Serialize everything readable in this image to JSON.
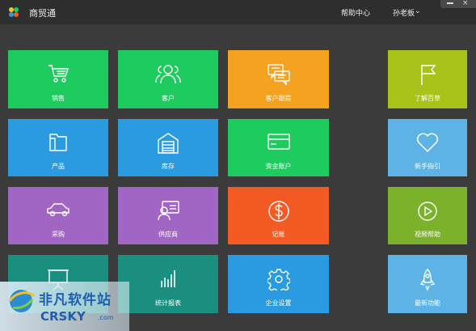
{
  "header": {
    "app_title": "商贸通",
    "help_label": "帮助中心",
    "user_label": "孙老板",
    "user_caret": "⌄",
    "close_glyph": "×"
  },
  "tiles": [
    {
      "label": "销售",
      "icon": "cart-icon",
      "color": "#1ecb5f"
    },
    {
      "label": "客户",
      "icon": "people-icon",
      "color": "#1ecb5f"
    },
    {
      "label": "客户跟踪",
      "icon": "chat-icon",
      "color": "#f4a21f"
    },
    {
      "label": "了解百草",
      "icon": "flag-icon",
      "color": "#a9c31a"
    },
    {
      "label": "产品",
      "icon": "folder-icon",
      "color": "#2a9be0"
    },
    {
      "label": "库存",
      "icon": "warehouse-icon",
      "color": "#2a9be0"
    },
    {
      "label": "资金账户",
      "icon": "card-icon",
      "color": "#1ecb5f"
    },
    {
      "label": "新手指引",
      "icon": "heart-icon",
      "color": "#5eb3e6"
    },
    {
      "label": "采购",
      "icon": "car-icon",
      "color": "#a166c4"
    },
    {
      "label": "供应商",
      "icon": "supplier-icon",
      "color": "#a166c4"
    },
    {
      "label": "记账",
      "icon": "dollar-icon",
      "color": "#f45a24"
    },
    {
      "label": "视频帮助",
      "icon": "play-icon",
      "color": "#7bb12b"
    },
    {
      "label": "",
      "icon": "presentation-icon",
      "color": "#1a8f80"
    },
    {
      "label": "统计报表",
      "icon": "bar-chart-icon",
      "color": "#1a8f80"
    },
    {
      "label": "企业设置",
      "icon": "gear-icon",
      "color": "#2a9be0"
    },
    {
      "label": "最新功能",
      "icon": "rocket-icon",
      "color": "#5eb3e6"
    }
  ],
  "watermark": {
    "cn_text": "非凡软件站",
    "en_text": "CRSKY",
    "com_text": ".com"
  }
}
